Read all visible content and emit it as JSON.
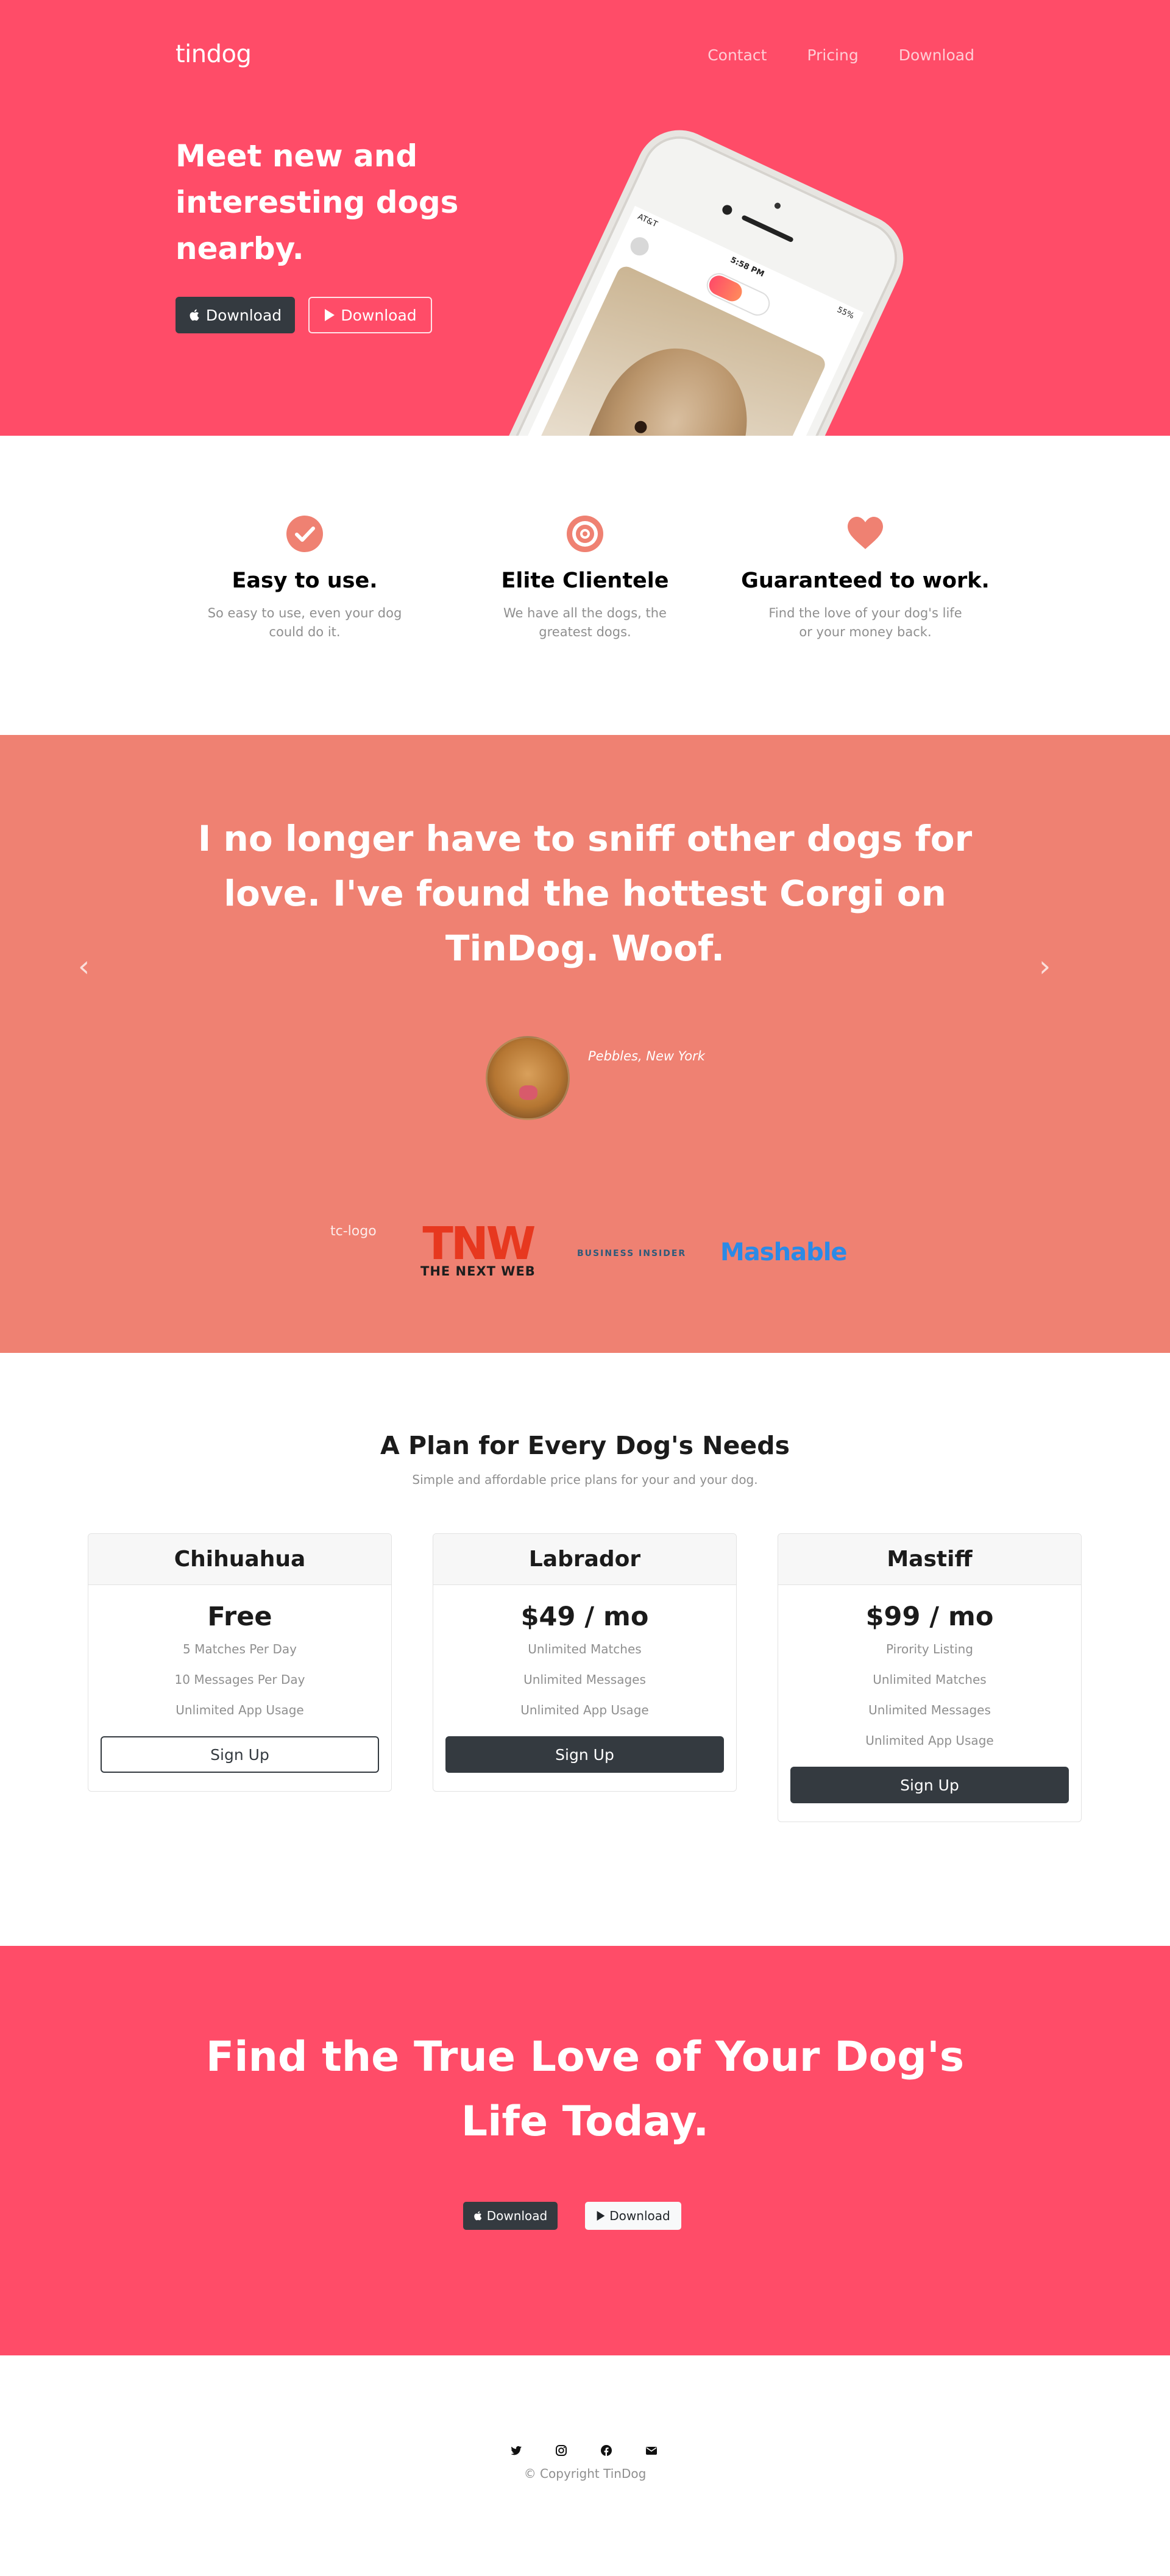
{
  "brand": {
    "name": "tindog"
  },
  "nav": {
    "items": [
      "Contact",
      "Pricing",
      "Download"
    ]
  },
  "hero": {
    "heading": "Meet new and interesting dogs nearby.",
    "apple_button_label": "Download",
    "google_button_label": "Download",
    "phone": {
      "carrier": "AT&T",
      "time": "5:58 PM",
      "battery": "55%"
    }
  },
  "features": [
    {
      "icon": "check-circle-icon",
      "title": "Easy to use.",
      "text": "So easy to use, even your dog could do it."
    },
    {
      "icon": "bullseye-icon",
      "title": "Elite Clientele",
      "text": "We have all the dogs, the greatest dogs."
    },
    {
      "icon": "heart-icon",
      "title": "Guaranteed to work.",
      "text": "Find the love of your dog's life or your money back."
    }
  ],
  "testimonial": {
    "quote": "I no longer have to sniff other dogs for love. I've found the hottest Corgi on TinDog. Woof.",
    "author": "Pebbles, New York"
  },
  "press": {
    "tc_alt": "tc-logo",
    "tnw_big": "TNW",
    "tnw_small": "THE NEXT WEB",
    "business_insider": "BUSINESS INSIDER",
    "mashable": "Mashable"
  },
  "pricing": {
    "title": "A Plan for Every Dog's Needs",
    "subtitle": "Simple and affordable price plans for your and your dog.",
    "plans": [
      {
        "name": "Chihuahua",
        "price": "Free",
        "features": [
          "5 Matches Per Day",
          "10 Messages Per Day",
          "Unlimited App Usage"
        ],
        "button": "Sign Up"
      },
      {
        "name": "Labrador",
        "price": "$49 / mo",
        "features": [
          "Unlimited Matches",
          "Unlimited Messages",
          "Unlimited App Usage"
        ],
        "button": "Sign Up"
      },
      {
        "name": "Mastiff",
        "price": "$99 / mo",
        "features": [
          "Pirority Listing",
          "Unlimited Matches",
          "Unlimited Messages",
          "Unlimited App Usage"
        ],
        "button": "Sign Up"
      }
    ]
  },
  "cta": {
    "title": "Find the True Love of Your Dog's Life Today.",
    "apple_button_label": "Download",
    "google_button_label": "Download"
  },
  "footer": {
    "social_icons": [
      "twitter-icon",
      "instagram-icon",
      "facebook-icon",
      "envelope-icon"
    ],
    "copyright": "© Copyright TinDog"
  },
  "colors": {
    "hero_bg": "#ff4c68",
    "testimonial_bg": "#ef8172",
    "accent_icon": "#ef8172",
    "dark_button": "#343a40"
  }
}
